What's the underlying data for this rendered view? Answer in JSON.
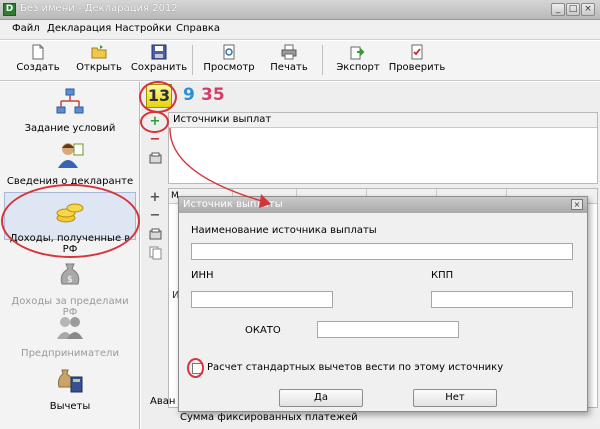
{
  "window": {
    "title": "Без имени - Декларация 2012",
    "minimize": "_",
    "maximize": "□",
    "close": "×"
  },
  "menu": [
    "Файл",
    "Декларация",
    "Настройки",
    "Справка"
  ],
  "toolbar": [
    {
      "label": "Создать",
      "icon": "new-file-icon"
    },
    {
      "label": "Открыть",
      "icon": "open-folder-icon"
    },
    {
      "label": "Сохранить",
      "icon": "save-disk-icon"
    },
    {
      "label": "Просмотр",
      "icon": "preview-icon"
    },
    {
      "label": "Печать",
      "icon": "printer-icon"
    },
    {
      "label": "Экспорт",
      "icon": "export-icon"
    },
    {
      "label": "Проверить",
      "icon": "check-document-icon"
    }
  ],
  "sidebar": [
    {
      "label": "Задание условий",
      "icon": "conditions-icon",
      "disabled": false
    },
    {
      "label": "Сведения о декларанте",
      "icon": "person-icon",
      "disabled": false
    },
    {
      "label": "Доходы, полученные в РФ",
      "icon": "coins-icon",
      "disabled": false,
      "active": true
    },
    {
      "label": "Доходы за пределами РФ",
      "icon": "money-bag-icon",
      "disabled": true
    },
    {
      "label": "Предприниматели",
      "icon": "entrepreneur-icon",
      "disabled": true
    },
    {
      "label": "Вычеты",
      "icon": "deductions-icon",
      "disabled": false
    }
  ],
  "rate_tabs": [
    "13",
    "9",
    "35"
  ],
  "sources_panel": {
    "header": "Источники выплат"
  },
  "income_panel": {
    "columns": [
      "М",
      "",
      "",
      "",
      ""
    ]
  },
  "bottom_text": {
    "advance": "Аван",
    "fixed_payments": "Сумма фиксированных платежей"
  },
  "dialog": {
    "title": "Источник выплаты",
    "close": "×",
    "name_label": "Наименование источника выплаты",
    "name_value": "",
    "inn_label": "ИНН",
    "inn_value": "",
    "kpp_label": "КПП",
    "kpp_value": "",
    "okato_label": "ОКАТО",
    "okato_value": "",
    "checkbox_label": "Расчет стандартных вычетов вести по этому источнику",
    "checkbox_checked": false,
    "ok_label": "Да",
    "cancel_label": "Нет"
  },
  "colors": {
    "annotation": "#d6343b",
    "accent_green": "#2e9e2e",
    "remove_red": "#c62828"
  }
}
